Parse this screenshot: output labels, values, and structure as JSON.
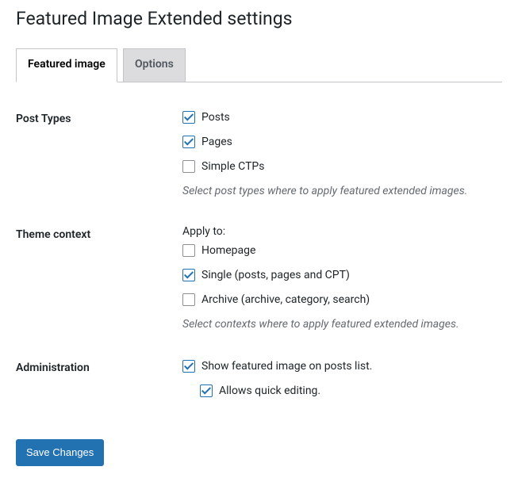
{
  "page": {
    "title": "Featured Image Extended settings"
  },
  "tabs": {
    "featured_image": "Featured image",
    "options": "Options"
  },
  "sections": {
    "post_types": {
      "heading": "Post Types",
      "items": {
        "posts": {
          "label": "Posts",
          "checked": true
        },
        "pages": {
          "label": "Pages",
          "checked": true
        },
        "simple_ctps": {
          "label": "Simple CTPs",
          "checked": false
        }
      },
      "description": "Select post types where to apply featured extended images."
    },
    "theme_context": {
      "heading": "Theme context",
      "apply_to_label": "Apply to:",
      "items": {
        "homepage": {
          "label": "Homepage",
          "checked": false
        },
        "single": {
          "label": "Single (posts, pages and CPT)",
          "checked": true
        },
        "archive": {
          "label": "Archive (archive, category, search)",
          "checked": false
        }
      },
      "description": "Select contexts where to apply featured extended images."
    },
    "administration": {
      "heading": "Administration",
      "items": {
        "show_featured": {
          "label": "Show featured image on posts list.",
          "checked": true
        },
        "allows_quick": {
          "label": "Allows quick editing.",
          "checked": true
        }
      }
    }
  },
  "submit": {
    "label": "Save Changes"
  }
}
